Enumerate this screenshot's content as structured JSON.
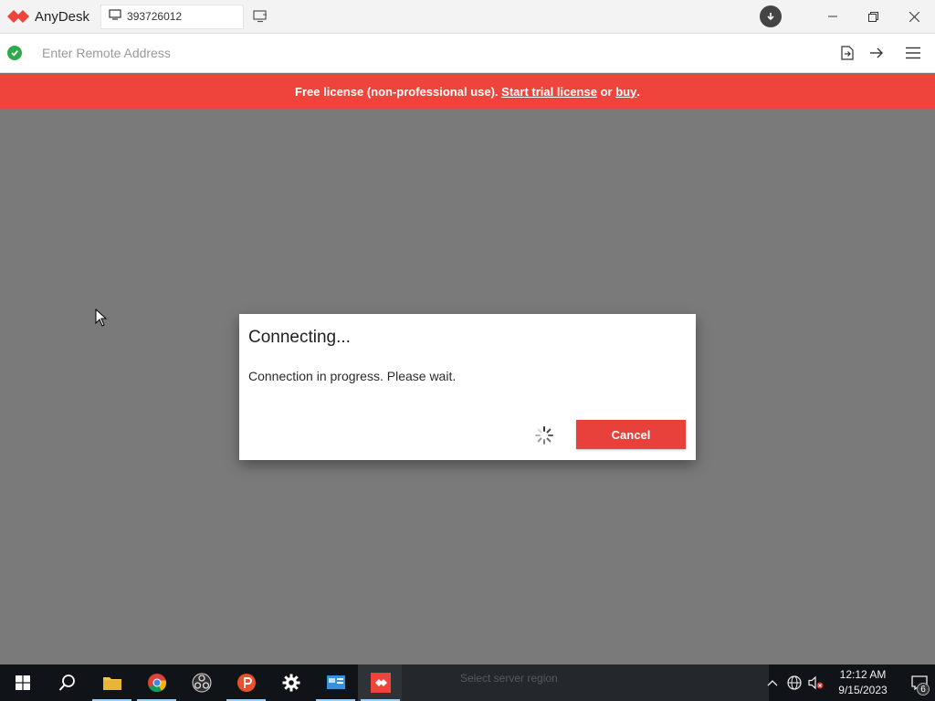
{
  "titlebar": {
    "app_name": "AnyDesk",
    "tab_label": "393726012"
  },
  "addressbar": {
    "placeholder": "Enter Remote Address"
  },
  "banner": {
    "prefix": "Free license (non-professional use). ",
    "trial_link": "Start trial license",
    "middle": " or ",
    "buy_link": "buy",
    "suffix": "."
  },
  "dialog": {
    "title": "Connecting...",
    "message": "Connection in progress. Please wait.",
    "cancel_label": "Cancel"
  },
  "taskbar": {
    "preview_text": "Select server region",
    "clock_time": "12:12 AM",
    "clock_date": "9/15/2023",
    "notification_count": "6"
  },
  "colors": {
    "brand_red": "#ef443b",
    "button_red": "#e8403a",
    "status_green": "#2eaa4c",
    "background_gray": "#7a7a7a"
  }
}
